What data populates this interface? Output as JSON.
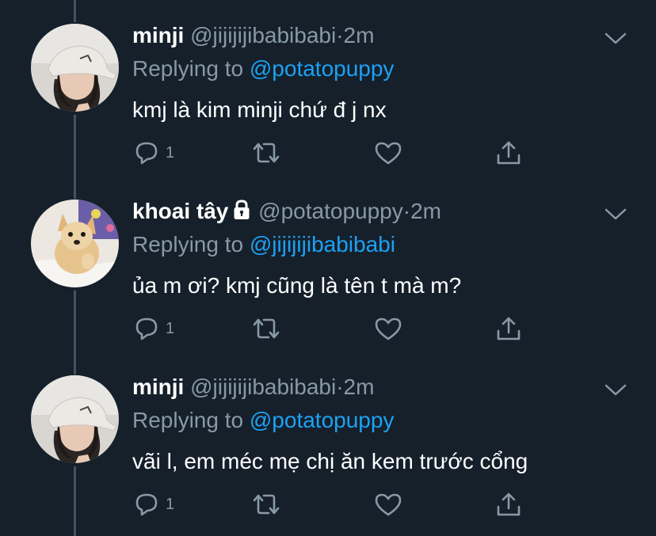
{
  "tweets": [
    {
      "name": "minji",
      "handle": "@jijijijibabibabi",
      "dot": "·",
      "time": "2m",
      "locked": false,
      "replying_prefix": "Replying to",
      "replying_handle": "@potatopuppy",
      "text": "kmj là kim minji chứ đ j nx",
      "reply_count": "1",
      "avatar": "girl-with-cap"
    },
    {
      "name": "khoai tây",
      "handle": "@potatopuppy",
      "dot": "·",
      "time": "2m",
      "locked": true,
      "replying_prefix": "Replying to",
      "replying_handle": "@jijijijibabibabi",
      "text": "ủa m ơi? kmj cũng là tên t mà m?",
      "reply_count": "1",
      "avatar": "chihuahua"
    },
    {
      "name": "minji",
      "handle": "@jijijijibabibabi",
      "dot": "·",
      "time": "2m",
      "locked": false,
      "replying_prefix": "Replying to",
      "replying_handle": "@potatopuppy",
      "text": "vãi l, em méc mẹ chị ăn kem trước cổng",
      "reply_count": "1",
      "avatar": "girl-with-cap"
    }
  ],
  "colors": {
    "background": "#15202b",
    "text": "#ffffff",
    "secondary": "#8899a6",
    "link": "#1da1f2",
    "thread_line": "#3d5466"
  },
  "icons": [
    "reply-icon",
    "retweet-icon",
    "like-icon",
    "share-icon",
    "chevron-down-icon",
    "lock-icon"
  ]
}
